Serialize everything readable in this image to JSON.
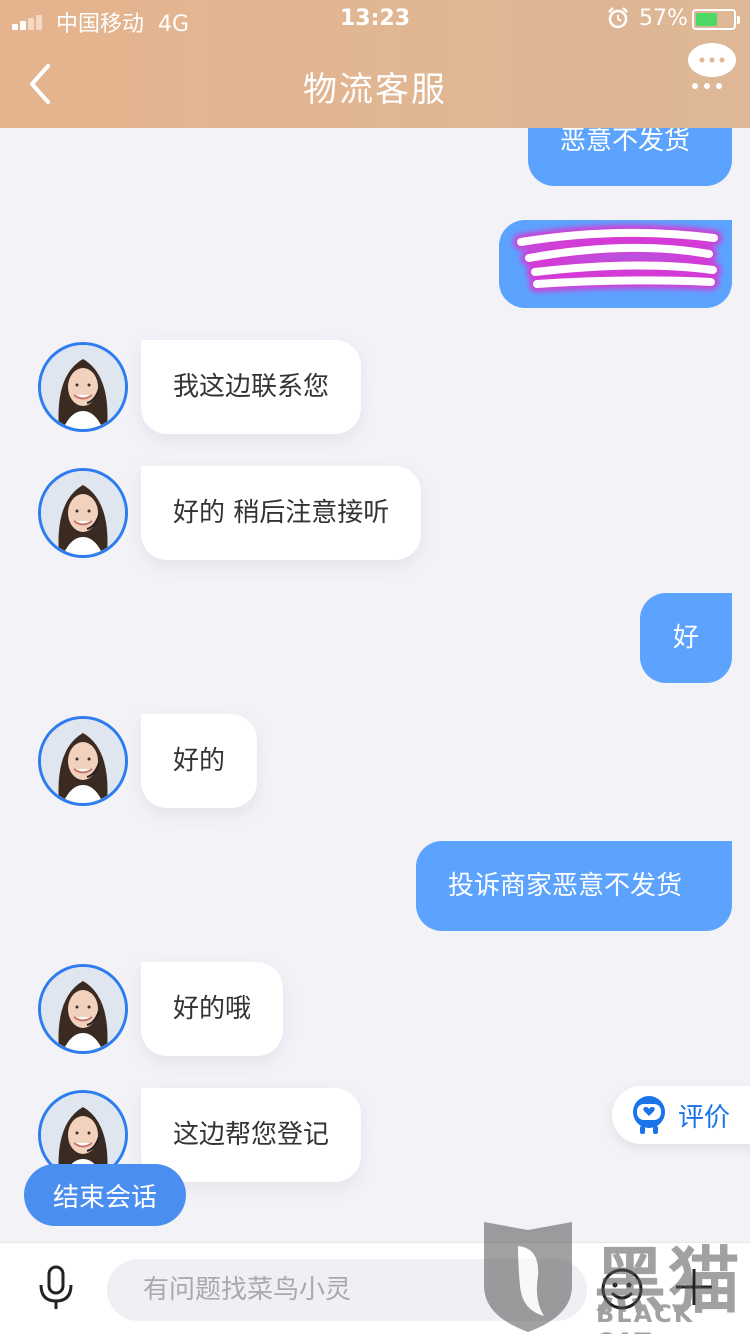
{
  "status_bar": {
    "carrier": "中国移动",
    "network": "4G",
    "time": "13:23",
    "battery": "57%",
    "battery_level": 0.57
  },
  "header": {
    "title": "物流客服",
    "back_icon": "chevron-left-icon",
    "more_icon": "chat-bubble-more-icon"
  },
  "messages": [
    {
      "sender": "user",
      "text": "恶意不发货"
    },
    {
      "sender": "user",
      "text": ""
    },
    {
      "sender": "agent",
      "text": "我这边联系您"
    },
    {
      "sender": "agent",
      "text": "好的 稍后注意接听"
    },
    {
      "sender": "user",
      "text": "好"
    },
    {
      "sender": "agent",
      "text": "好的"
    },
    {
      "sender": "user",
      "text": "投诉商家恶意不发货"
    },
    {
      "sender": "agent",
      "text": "好的哦"
    },
    {
      "sender": "agent",
      "text": "这边帮您登记"
    }
  ],
  "rate": {
    "label": "评价"
  },
  "end_session": {
    "label": "结束会话"
  },
  "input": {
    "placeholder": "有问题找菜鸟小灵",
    "value": ""
  },
  "watermark": {
    "cn": "黑猫",
    "en": "BLACK CAT"
  },
  "colors": {
    "header": "#e5b48e",
    "user_bubble": "#5ba3ff",
    "agent_bubble": "#ffffff",
    "end_button": "#4a8ef0",
    "accent": "#1a73e8"
  }
}
